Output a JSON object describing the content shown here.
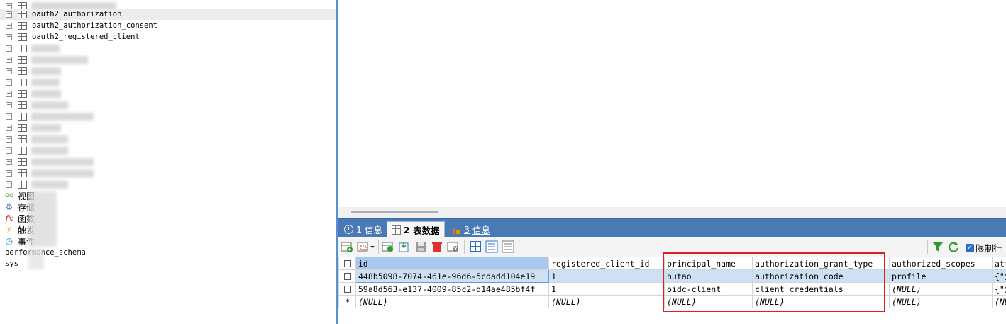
{
  "tree": {
    "tables": [
      {
        "label": "",
        "selected": false
      },
      {
        "label": "oauth2_authorization",
        "selected": true
      },
      {
        "label": "oauth2_authorization_consent",
        "selected": false
      },
      {
        "label": "oauth2_registered_client",
        "selected": false
      }
    ],
    "categories": [
      {
        "icon": "views-icon",
        "label": "视图"
      },
      {
        "icon": "stored-procedures-icon",
        "label": "存储"
      },
      {
        "icon": "functions-icon",
        "label": "函数"
      },
      {
        "icon": "triggers-icon",
        "label": "触发"
      },
      {
        "icon": "events-icon",
        "label": "事件"
      }
    ],
    "databases": [
      "performance_schema",
      "sys"
    ]
  },
  "tabs": [
    {
      "number": "1",
      "label": "信息",
      "icon": "info-icon"
    },
    {
      "number": "2",
      "label": "表数据",
      "icon": "table-grid-icon"
    },
    {
      "number": "3",
      "label": "信息",
      "icon": "chart-icon"
    }
  ],
  "toolbar": {
    "limit_label": "限制行",
    "limit_checked": true
  },
  "grid": {
    "columns": [
      "id",
      "registered_client_id",
      "principal_name",
      "authorization_grant_type",
      "authorized_scopes",
      "att"
    ],
    "rows": [
      {
        "marker": "",
        "cells": [
          "448b5098-7074-461e-96d6-5cdadd104e19",
          "1",
          "hutao",
          "authorization_code",
          "profile",
          "{\"@"
        ]
      },
      {
        "marker": "",
        "cells": [
          "59a8d563-e137-4009-85c2-d14ae485bf4f",
          "1",
          "oidc-client",
          "client_credentials",
          "(NULL)",
          "{\"@"
        ]
      },
      {
        "marker": "*",
        "cells": [
          "(NULL)",
          "(NULL)",
          "(NULL)",
          "(NULL)",
          "(NULL)",
          "(NUL"
        ]
      }
    ]
  },
  "colors": {
    "tab_bar": "#4a7ab5",
    "selected_row": "#cfe0f5",
    "highlight_box": "#e02020"
  }
}
